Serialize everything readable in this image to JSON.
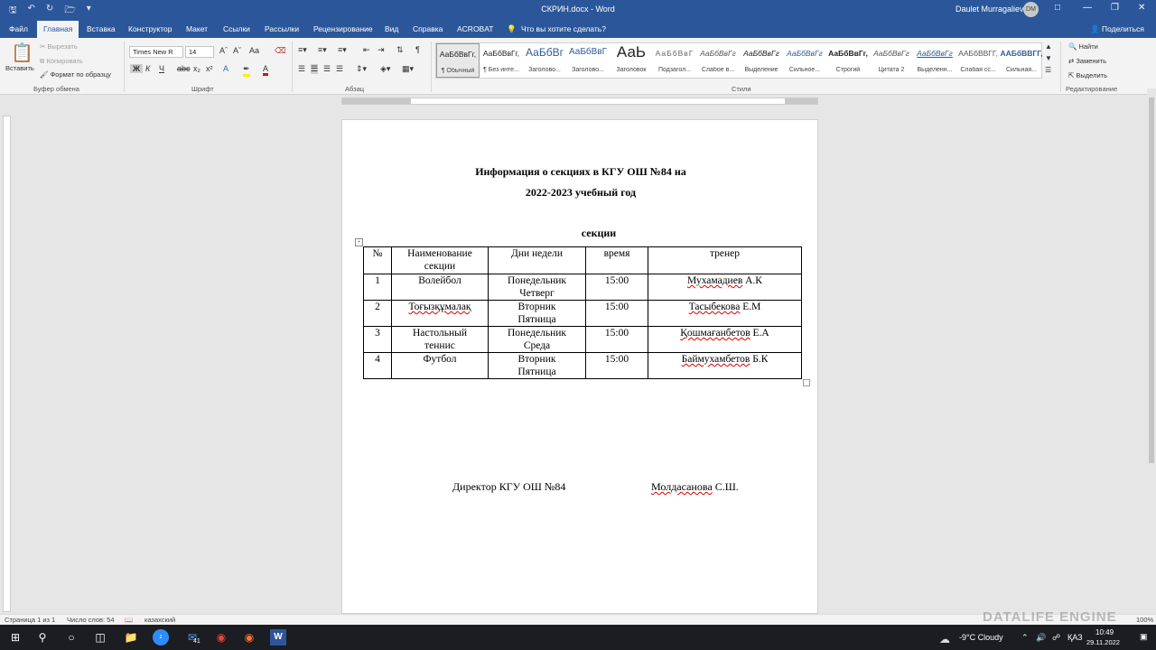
{
  "window": {
    "title": "СКРИН.docx  -  Word",
    "user": "Daulet Murragaliev",
    "avatar_initials": "DM"
  },
  "menu": {
    "tabs": [
      "Файл",
      "Главная",
      "Вставка",
      "Конструктор",
      "Макет",
      "Ссылки",
      "Рассылки",
      "Рецензирование",
      "Вид",
      "Справка",
      "ACROBAT"
    ],
    "tell_me": "Что вы хотите сделать?",
    "share": "Поделиться"
  },
  "ribbon": {
    "clipboard": {
      "paste": "Вставить",
      "cut": "Вырезать",
      "copy": "Копировать",
      "format_painter": "Формат по образцу",
      "group": "Буфер обмена"
    },
    "font": {
      "name": "Times New R",
      "size": "14",
      "group": "Шрифт"
    },
    "paragraph": {
      "group": "Абзац"
    },
    "styles": {
      "group": "Стили",
      "items": [
        {
          "preview": "АаБбВвГг,",
          "name": "¶ Обычный"
        },
        {
          "preview": "АаБбВвГг,",
          "name": "¶ Без инте..."
        },
        {
          "preview": "АаБбВг",
          "name": "Заголово..."
        },
        {
          "preview": "АаБбВвГ",
          "name": "Заголово..."
        },
        {
          "preview": "АаЬ",
          "name": "Заголовок"
        },
        {
          "preview": "АаБбВвГ",
          "name": "Подзагол..."
        },
        {
          "preview": "АаБбВвГг",
          "name": "Слабое в..."
        },
        {
          "preview": "АаБбВвГг",
          "name": "Выделение"
        },
        {
          "preview": "АаБбВвГг",
          "name": "Сильное..."
        },
        {
          "preview": "АаБбВвГг,",
          "name": "Строгий"
        },
        {
          "preview": "АаБбВвГг",
          "name": "Цитата 2"
        },
        {
          "preview": "АаБбВвГг",
          "name": "Выделенн..."
        },
        {
          "preview": "ААБбВВГГ,",
          "name": "Слабая сс..."
        },
        {
          "preview": "ААБбВВГГ,",
          "name": "Сильная..."
        }
      ]
    },
    "editing": {
      "find": "Найти",
      "replace": "Заменить",
      "select": "Выделить",
      "group": "Редактирование"
    }
  },
  "document": {
    "title1": "Информация о секциях в КГУ ОШ №84 на",
    "title2": "2022-2023 учебный год",
    "subtitle": "секции",
    "table_headers": [
      "№",
      "Наименование секции",
      "Дни недели",
      "время",
      "тренер"
    ],
    "rows": [
      {
        "num": "1",
        "name": "Волейбол",
        "days": "Понедельник Четверг",
        "time": "15:00",
        "coach_surname": "Мухамадиев",
        "coach_init": "А.К"
      },
      {
        "num": "2",
        "name": "Тоғызқұмалақ",
        "days": "Вторник Пятница",
        "time": "15:00",
        "coach_surname": "Тасыбекова",
        "coach_init": "Е.М"
      },
      {
        "num": "3",
        "name": "Настольный теннис",
        "days": "Понедельник Среда",
        "time": "15:00",
        "coach_surname": "Қошмағанбетов",
        "coach_init": "Е.А"
      },
      {
        "num": "4",
        "name": "Футбол",
        "days": "Вторник Пятница",
        "time": "15:00",
        "coach_surname": "Баймухамбетов",
        "coach_init": "Б.К"
      }
    ],
    "director_label": "Директор КГУ ОШ №84",
    "director_surname": "Молдасанова",
    "director_init": "С.Ш."
  },
  "status": {
    "page": "Страница 1 из 1",
    "words": "Число слов: 54",
    "language": "казахский",
    "zoom": "100%"
  },
  "taskbar": {
    "weather": "-9°C  Cloudy",
    "lang": "ҚАЗ",
    "time": "10:49",
    "date": "29.11.2022",
    "badge": "41"
  },
  "watermark": "DATALIFE ENGINE"
}
